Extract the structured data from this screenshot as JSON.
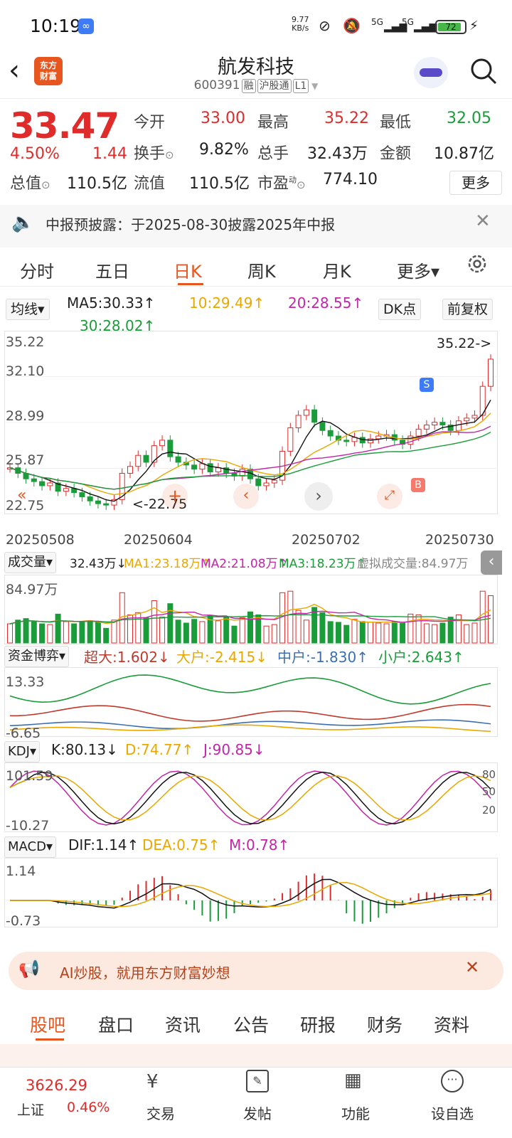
{
  "status": {
    "time": "10:19",
    "net_speed_value": "9.77",
    "net_speed_unit": "KB/s",
    "signal1": "5G",
    "signal2": "5G",
    "battery": "72"
  },
  "header": {
    "title": "航发科技",
    "code": "600391",
    "tags": [
      "融",
      "沪股通",
      "L1"
    ],
    "logo_line1": "东方",
    "logo_line2": "财富"
  },
  "quote": {
    "price": "33.47",
    "change_pct": "4.50%",
    "change": "1.44",
    "fields": [
      {
        "label": "今开",
        "value": "33.00"
      },
      {
        "label": "最高",
        "value": "35.22"
      },
      {
        "label": "最低",
        "value": "32.05"
      },
      {
        "label": "换手",
        "value": "9.82%"
      },
      {
        "label": "总手",
        "value": "32.43万"
      },
      {
        "label": "金额",
        "value": "10.87亿"
      },
      {
        "label": "总值",
        "value": "110.5亿"
      },
      {
        "label": "流值",
        "value": "110.5亿"
      },
      {
        "label": "市盈",
        "value": "774.10"
      }
    ],
    "pe_sup": "动",
    "more": "更多"
  },
  "notice": {
    "text": "中报预披露：于2025-08-30披露2025年中报"
  },
  "chart_tabs": [
    "分时",
    "五日",
    "日K",
    "周K",
    "月K",
    "更多▾"
  ],
  "active_tab": "日K",
  "ma": {
    "selector": "均线▾",
    "ma5": "MA5:30.33↑",
    "ma10": "10:29.49↑",
    "ma20": "20:28.55↑",
    "ma30": "30:28.02↑",
    "dk": "DK点",
    "fq": "前复权"
  },
  "kchart": {
    "y_ticks": [
      "35.22",
      "32.10",
      "28.99",
      "25.87",
      "22.75"
    ],
    "max_label": "35.22->",
    "min_label": "<-22.75",
    "dates": [
      "20250508",
      "20250604",
      "20250702",
      "20250730"
    ],
    "s_mark": "S",
    "b_mark": "B"
  },
  "volume": {
    "selector": "成交量▾",
    "value": "32.43万↓",
    "ma1": "MA1:23.18万↑",
    "ma2": "MA2:21.08万↑",
    "ma3": "MA3:18.23万↑",
    "virtual": "虚拟成交量:84.97万",
    "max": "84.97万"
  },
  "capital": {
    "selector": "资金博弈▾",
    "cd": "超大:1.602↓",
    "dh": "大户:-2.415↓",
    "zh": "中户:-1.830↑",
    "xh": "小户:2.643↑",
    "top": "13.33",
    "bottom": "-6.65"
  },
  "kdj": {
    "selector": "KDJ▾",
    "k": "K:80.13↓",
    "d": "D:74.77↑",
    "j": "J:90.85↓",
    "top": "101.59",
    "bottom": "-10.27",
    "r80": "80",
    "r50": "50",
    "r20": "20"
  },
  "macd": {
    "selector": "MACD▾",
    "dif": "DIF:1.14↑",
    "dea": "DEA:0.75↑",
    "m": "M:0.78↑",
    "top": "1.14",
    "bottom": "-0.73"
  },
  "banner": {
    "text": "AI炒股，就用东方财富妙想"
  },
  "bottom_tabs": [
    "股吧",
    "盘口",
    "资讯",
    "公告",
    "研报",
    "财务",
    "资料"
  ],
  "bottom_nav": {
    "index_value": "3626.29",
    "index_name": "上证",
    "index_pct": "0.46%",
    "items": [
      "交易",
      "发帖",
      "功能",
      "设自选"
    ]
  },
  "chart_data": {
    "type": "candlestick",
    "title": "航发科技 日K",
    "y_range": [
      22.75,
      35.22
    ],
    "x_dates": [
      "20250508",
      "20250604",
      "20250702",
      "20250730"
    ],
    "closes": [
      25.6,
      25.2,
      24.8,
      24.6,
      24.3,
      24.5,
      23.9,
      24.1,
      23.8,
      23.5,
      23.2,
      23.0,
      22.9,
      23.3,
      25.2,
      25.7,
      26.5,
      26.0,
      27.2,
      27.6,
      26.4,
      26.0,
      25.8,
      25.5,
      25.9,
      25.3,
      25.6,
      25.2,
      25.0,
      25.5,
      24.8,
      24.3,
      24.5,
      24.7,
      26.8,
      28.5,
      29.4,
      29.8,
      28.9,
      28.3,
      27.9,
      27.6,
      27.5,
      27.8,
      27.4,
      27.7,
      27.9,
      28.0,
      27.6,
      27.3,
      27.9,
      28.4,
      28.7,
      28.9,
      28.7,
      28.3,
      29.0,
      29.2,
      29.4,
      31.5,
      33.47
    ]
  }
}
